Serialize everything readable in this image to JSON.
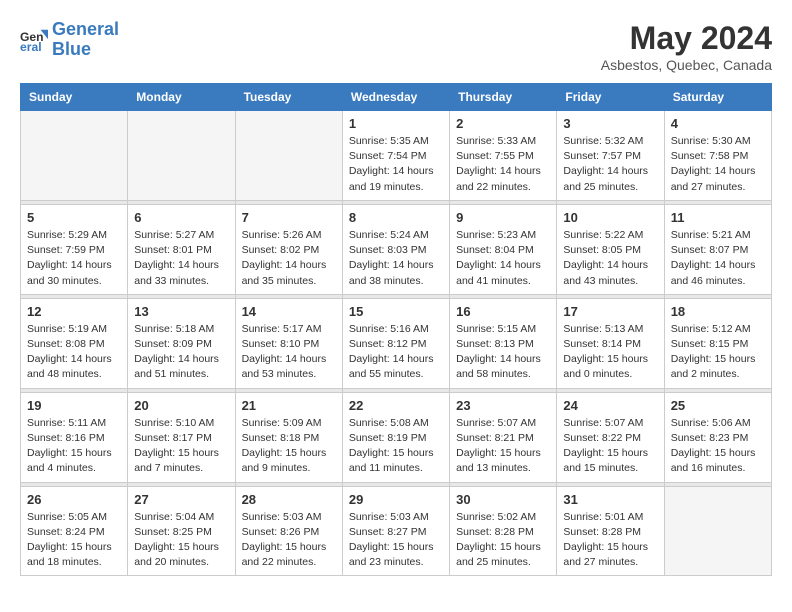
{
  "header": {
    "logo_line1": "General",
    "logo_line2": "Blue",
    "month_year": "May 2024",
    "location": "Asbestos, Quebec, Canada"
  },
  "days_of_week": [
    "Sunday",
    "Monday",
    "Tuesday",
    "Wednesday",
    "Thursday",
    "Friday",
    "Saturday"
  ],
  "weeks": [
    [
      {
        "num": "",
        "info": ""
      },
      {
        "num": "",
        "info": ""
      },
      {
        "num": "",
        "info": ""
      },
      {
        "num": "1",
        "info": "Sunrise: 5:35 AM\nSunset: 7:54 PM\nDaylight: 14 hours\nand 19 minutes."
      },
      {
        "num": "2",
        "info": "Sunrise: 5:33 AM\nSunset: 7:55 PM\nDaylight: 14 hours\nand 22 minutes."
      },
      {
        "num": "3",
        "info": "Sunrise: 5:32 AM\nSunset: 7:57 PM\nDaylight: 14 hours\nand 25 minutes."
      },
      {
        "num": "4",
        "info": "Sunrise: 5:30 AM\nSunset: 7:58 PM\nDaylight: 14 hours\nand 27 minutes."
      }
    ],
    [
      {
        "num": "5",
        "info": "Sunrise: 5:29 AM\nSunset: 7:59 PM\nDaylight: 14 hours\nand 30 minutes."
      },
      {
        "num": "6",
        "info": "Sunrise: 5:27 AM\nSunset: 8:01 PM\nDaylight: 14 hours\nand 33 minutes."
      },
      {
        "num": "7",
        "info": "Sunrise: 5:26 AM\nSunset: 8:02 PM\nDaylight: 14 hours\nand 35 minutes."
      },
      {
        "num": "8",
        "info": "Sunrise: 5:24 AM\nSunset: 8:03 PM\nDaylight: 14 hours\nand 38 minutes."
      },
      {
        "num": "9",
        "info": "Sunrise: 5:23 AM\nSunset: 8:04 PM\nDaylight: 14 hours\nand 41 minutes."
      },
      {
        "num": "10",
        "info": "Sunrise: 5:22 AM\nSunset: 8:05 PM\nDaylight: 14 hours\nand 43 minutes."
      },
      {
        "num": "11",
        "info": "Sunrise: 5:21 AM\nSunset: 8:07 PM\nDaylight: 14 hours\nand 46 minutes."
      }
    ],
    [
      {
        "num": "12",
        "info": "Sunrise: 5:19 AM\nSunset: 8:08 PM\nDaylight: 14 hours\nand 48 minutes."
      },
      {
        "num": "13",
        "info": "Sunrise: 5:18 AM\nSunset: 8:09 PM\nDaylight: 14 hours\nand 51 minutes."
      },
      {
        "num": "14",
        "info": "Sunrise: 5:17 AM\nSunset: 8:10 PM\nDaylight: 14 hours\nand 53 minutes."
      },
      {
        "num": "15",
        "info": "Sunrise: 5:16 AM\nSunset: 8:12 PM\nDaylight: 14 hours\nand 55 minutes."
      },
      {
        "num": "16",
        "info": "Sunrise: 5:15 AM\nSunset: 8:13 PM\nDaylight: 14 hours\nand 58 minutes."
      },
      {
        "num": "17",
        "info": "Sunrise: 5:13 AM\nSunset: 8:14 PM\nDaylight: 15 hours\nand 0 minutes."
      },
      {
        "num": "18",
        "info": "Sunrise: 5:12 AM\nSunset: 8:15 PM\nDaylight: 15 hours\nand 2 minutes."
      }
    ],
    [
      {
        "num": "19",
        "info": "Sunrise: 5:11 AM\nSunset: 8:16 PM\nDaylight: 15 hours\nand 4 minutes."
      },
      {
        "num": "20",
        "info": "Sunrise: 5:10 AM\nSunset: 8:17 PM\nDaylight: 15 hours\nand 7 minutes."
      },
      {
        "num": "21",
        "info": "Sunrise: 5:09 AM\nSunset: 8:18 PM\nDaylight: 15 hours\nand 9 minutes."
      },
      {
        "num": "22",
        "info": "Sunrise: 5:08 AM\nSunset: 8:19 PM\nDaylight: 15 hours\nand 11 minutes."
      },
      {
        "num": "23",
        "info": "Sunrise: 5:07 AM\nSunset: 8:21 PM\nDaylight: 15 hours\nand 13 minutes."
      },
      {
        "num": "24",
        "info": "Sunrise: 5:07 AM\nSunset: 8:22 PM\nDaylight: 15 hours\nand 15 minutes."
      },
      {
        "num": "25",
        "info": "Sunrise: 5:06 AM\nSunset: 8:23 PM\nDaylight: 15 hours\nand 16 minutes."
      }
    ],
    [
      {
        "num": "26",
        "info": "Sunrise: 5:05 AM\nSunset: 8:24 PM\nDaylight: 15 hours\nand 18 minutes."
      },
      {
        "num": "27",
        "info": "Sunrise: 5:04 AM\nSunset: 8:25 PM\nDaylight: 15 hours\nand 20 minutes."
      },
      {
        "num": "28",
        "info": "Sunrise: 5:03 AM\nSunset: 8:26 PM\nDaylight: 15 hours\nand 22 minutes."
      },
      {
        "num": "29",
        "info": "Sunrise: 5:03 AM\nSunset: 8:27 PM\nDaylight: 15 hours\nand 23 minutes."
      },
      {
        "num": "30",
        "info": "Sunrise: 5:02 AM\nSunset: 8:28 PM\nDaylight: 15 hours\nand 25 minutes."
      },
      {
        "num": "31",
        "info": "Sunrise: 5:01 AM\nSunset: 8:28 PM\nDaylight: 15 hours\nand 27 minutes."
      },
      {
        "num": "",
        "info": ""
      }
    ]
  ]
}
